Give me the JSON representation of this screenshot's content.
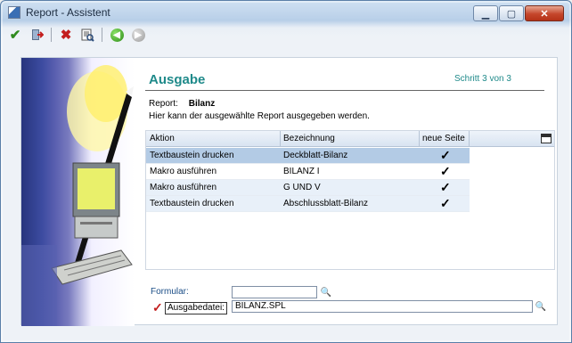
{
  "window": {
    "title": "Report - Assistent"
  },
  "panel": {
    "title": "Ausgabe",
    "step": "Schritt 3 von 3"
  },
  "report": {
    "label": "Report:",
    "name": "Bilanz",
    "description": "Hier kann der ausgewählte Report ausgegeben werden."
  },
  "table": {
    "columns": [
      "Aktion",
      "Bezeichnung",
      "neue Seite"
    ],
    "rows": [
      {
        "aktion": "Textbaustein drucken",
        "bezeichnung": "Deckblatt-Bilanz",
        "neue_seite": "✓",
        "selected": true
      },
      {
        "aktion": "Makro ausführen",
        "bezeichnung": "BILANZ I",
        "neue_seite": "✓",
        "selected": false
      },
      {
        "aktion": "Makro ausführen",
        "bezeichnung": "G UND V",
        "neue_seite": "✓",
        "selected": false
      },
      {
        "aktion": "Textbaustein drucken",
        "bezeichnung": "Abschlussblatt-Bilanz",
        "neue_seite": "✓",
        "selected": false
      }
    ]
  },
  "form": {
    "formular_label": "Formular:",
    "formular_value": "",
    "ausgabedatei_label": "Ausgabedatei:",
    "ausgabedatei_value": "BILANZ.SPL",
    "ausgabedatei_checked": true
  },
  "colors": {
    "accent": "#1f8a8a",
    "selection": "#b3cbe5",
    "alt_row": "#e8f0f9"
  },
  "icons": {
    "toolbar": [
      "check-icon",
      "exit-icon",
      "delete-icon",
      "print-preview-icon",
      "back-icon",
      "forward-icon"
    ],
    "window": [
      "minimize-icon",
      "maximize-icon",
      "close-icon"
    ]
  }
}
